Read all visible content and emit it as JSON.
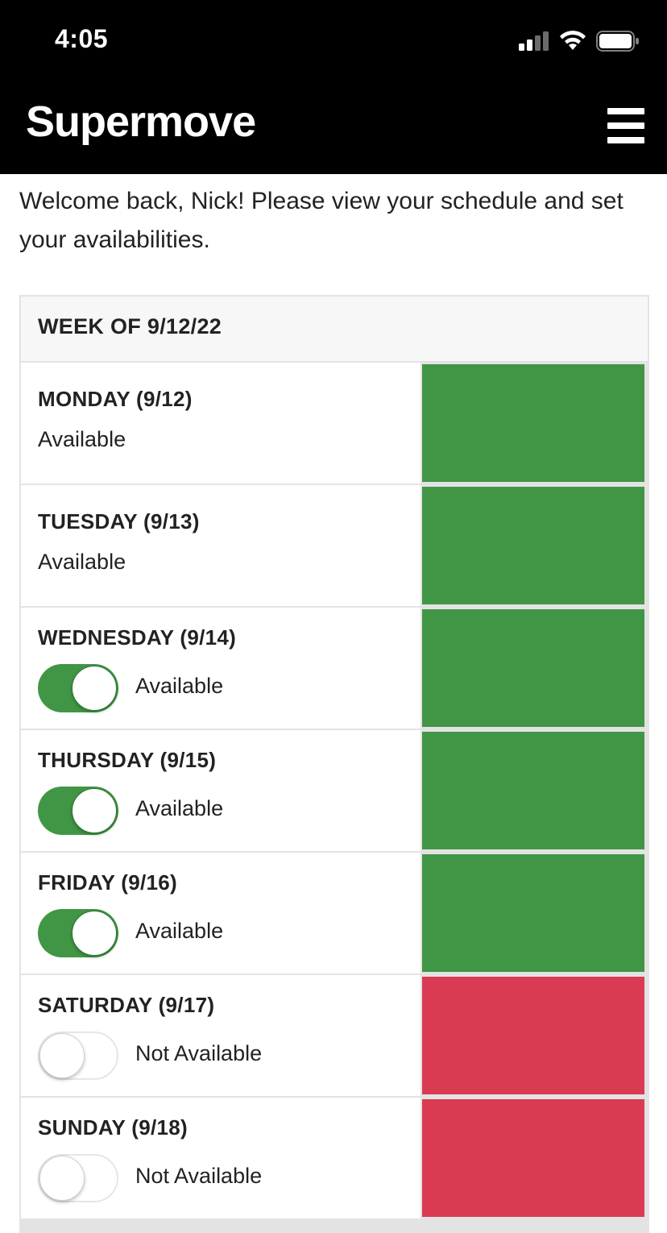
{
  "status_bar": {
    "time": "4:05"
  },
  "header": {
    "app_title": "Supermove",
    "menu_icon": "hamburger-menu-icon"
  },
  "welcome_text": "Welcome back, Nick! Please view your schedule and set your availabilities.",
  "schedule": {
    "week_title": "WEEK OF 9/12/22",
    "colors": {
      "available": "#419645",
      "not_available": "#d93b53"
    },
    "days": [
      {
        "label": "MONDAY (9/12)",
        "status": "Available",
        "editable": false,
        "available": true
      },
      {
        "label": "TUESDAY (9/13)",
        "status": "Available",
        "editable": false,
        "available": true
      },
      {
        "label": "WEDNESDAY (9/14)",
        "status": "Available",
        "editable": true,
        "available": true
      },
      {
        "label": "THURSDAY (9/15)",
        "status": "Available",
        "editable": true,
        "available": true
      },
      {
        "label": "FRIDAY (9/16)",
        "status": "Available",
        "editable": true,
        "available": true
      },
      {
        "label": "SATURDAY (9/17)",
        "status": "Not Available",
        "editable": true,
        "available": false
      },
      {
        "label": "SUNDAY (9/18)",
        "status": "Not Available",
        "editable": true,
        "available": false
      }
    ]
  }
}
